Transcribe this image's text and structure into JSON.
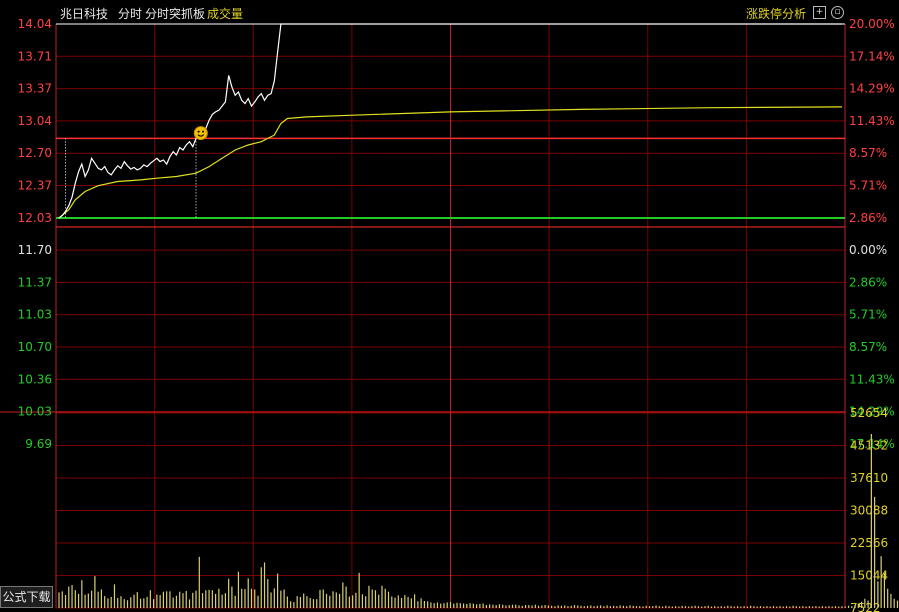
{
  "header": {
    "stock_name": "兆日科技",
    "menu_intraday": "分时",
    "menu_breakout": "分时突抓板",
    "volume_label": "成交量",
    "limit_analysis": "涨跌停分析",
    "plus_icon": "plus-icon",
    "circle_icon": "circle-toggle-icon"
  },
  "footer": {
    "formula_download": "公式下载"
  },
  "colors": {
    "up": "#ff4040",
    "down": "#22cc22",
    "neutral": "#e0e0e0",
    "grid": "#7a0000",
    "price_line": "#ffffff",
    "avg_line": "#e0e020",
    "volume": "#d8d070",
    "accent": "#e0d020"
  },
  "chart_data": {
    "type": "line",
    "base_price": 11.7,
    "price_axis_labels": [
      "14.04",
      "13.71",
      "13.37",
      "13.04",
      "12.70",
      "12.37",
      "12.03",
      "11.70",
      "11.37",
      "11.03",
      "10.70",
      "10.36",
      "10.03",
      "9.69"
    ],
    "percent_axis_labels": [
      "20.00%",
      "17.14%",
      "14.29%",
      "11.43%",
      "8.57%",
      "5.71%",
      "2.86%",
      "0.00%",
      "2.86%",
      "5.71%",
      "8.57%",
      "11.43%",
      "14.29%",
      "17.14%"
    ],
    "volume_axis_labels": [
      "52654",
      "45132",
      "37610",
      "30088",
      "22566",
      "15044",
      "7522"
    ],
    "ylim": [
      9.36,
      14.04
    ],
    "volume_max": 52654,
    "session_minutes": 240,
    "limit_up_price": 14.04,
    "reference_price": 12.66,
    "series": [
      {
        "points": [
          [
            0,
            11.7
          ],
          [
            1,
            11.73
          ],
          [
            2,
            11.78
          ],
          [
            3,
            11.85
          ],
          [
            4,
            11.95
          ],
          [
            5,
            12.12
          ],
          [
            6,
            12.26
          ],
          [
            7,
            12.35
          ],
          [
            8,
            12.2
          ],
          [
            9,
            12.28
          ],
          [
            10,
            12.42
          ],
          [
            11,
            12.36
          ],
          [
            12,
            12.3
          ],
          [
            13,
            12.28
          ],
          [
            14,
            12.32
          ],
          [
            15,
            12.25
          ],
          [
            16,
            12.22
          ],
          [
            17,
            12.28
          ],
          [
            18,
            12.33
          ],
          [
            19,
            12.3
          ],
          [
            20,
            12.38
          ],
          [
            21,
            12.33
          ],
          [
            22,
            12.29
          ],
          [
            23,
            12.31
          ],
          [
            24,
            12.28
          ],
          [
            25,
            12.3
          ],
          [
            26,
            12.34
          ],
          [
            27,
            12.32
          ],
          [
            28,
            12.36
          ],
          [
            29,
            12.39
          ],
          [
            30,
            12.42
          ],
          [
            31,
            12.38
          ],
          [
            32,
            12.4
          ],
          [
            33,
            12.35
          ],
          [
            34,
            12.44
          ],
          [
            35,
            12.5
          ],
          [
            36,
            12.46
          ],
          [
            37,
            12.55
          ],
          [
            38,
            12.52
          ],
          [
            39,
            12.58
          ],
          [
            40,
            12.62
          ],
          [
            41,
            12.56
          ],
          [
            42,
            12.66
          ],
          [
            43,
            12.72
          ],
          [
            44,
            12.7
          ],
          [
            45,
            12.78
          ],
          [
            46,
            12.88
          ],
          [
            47,
            12.95
          ],
          [
            48,
            12.98
          ],
          [
            49,
            13.0
          ],
          [
            50,
            13.05
          ],
          [
            51,
            13.1
          ],
          [
            52,
            13.42
          ],
          [
            53,
            13.28
          ],
          [
            54,
            13.18
          ],
          [
            55,
            13.22
          ],
          [
            56,
            13.12
          ],
          [
            57,
            13.08
          ],
          [
            58,
            13.14
          ],
          [
            59,
            13.05
          ],
          [
            60,
            13.1
          ],
          [
            61,
            13.16
          ],
          [
            62,
            13.2
          ],
          [
            63,
            13.12
          ],
          [
            64,
            13.18
          ],
          [
            65,
            13.2
          ],
          [
            66,
            13.35
          ],
          [
            67,
            13.7
          ],
          [
            68,
            14.04
          ],
          [
            240,
            14.04
          ]
        ]
      },
      {
        "points": [
          [
            0,
            11.7
          ],
          [
            3,
            11.8
          ],
          [
            5,
            11.92
          ],
          [
            8,
            12.02
          ],
          [
            12,
            12.09
          ],
          [
            18,
            12.14
          ],
          [
            25,
            12.16
          ],
          [
            30,
            12.18
          ],
          [
            36,
            12.2
          ],
          [
            42,
            12.24
          ],
          [
            46,
            12.32
          ],
          [
            50,
            12.42
          ],
          [
            54,
            12.52
          ],
          [
            58,
            12.58
          ],
          [
            62,
            12.62
          ],
          [
            66,
            12.7
          ],
          [
            68,
            12.84
          ],
          [
            70,
            12.9
          ],
          [
            76,
            12.92
          ],
          [
            90,
            12.94
          ],
          [
            120,
            12.98
          ],
          [
            160,
            13.01
          ],
          [
            200,
            13.03
          ],
          [
            240,
            13.04
          ]
        ]
      }
    ],
    "volumes": [
      4200,
      4500,
      3500,
      5800,
      6200,
      4800,
      3800,
      7500,
      3600,
      3900,
      4700,
      8600,
      4400,
      5000,
      3200,
      2600,
      3000,
      6400,
      2700,
      3200,
      2400,
      2100,
      2900,
      3600,
      4300,
      2500,
      2600,
      3000,
      4800,
      2400,
      3600,
      3500,
      4400,
      4500,
      4500,
      2800,
      3300,
      4400,
      4000,
      4600,
      2300,
      4100,
      4700,
      13800,
      4000,
      4800,
      4900,
      4800,
      3800,
      5200,
      3600,
      4000,
      7900,
      5800,
      3300,
      9800,
      5200,
      5100,
      8000,
      5200,
      5000,
      3300,
      11000,
      12300,
      7800,
      4200,
      5300,
      9300,
      4700,
      5000,
      3100,
      1800,
      1600,
      3200,
      3000,
      3900,
      3200,
      2700,
      2400,
      2400,
      4900,
      5000,
      3800,
      3300,
      4500,
      4200,
      3800,
      6900,
      5800,
      3100,
      3400,
      4100,
      9500,
      3700,
      3200,
      6000,
      5000,
      4800,
      3600,
      6000,
      5200,
      4400,
      3100,
      2800,
      3400,
      2700,
      3500,
      3000,
      2600,
      3700,
      1800,
      2600,
      1900,
      1800,
      1500,
      1300,
      1500,
      1200,
      1300,
      1500,
      1600,
      1200,
      1400,
      1300,
      1200,
      1100,
      1300,
      1200,
      1000,
      1100,
      1200,
      800,
      1000,
      900,
      800,
      1000,
      900,
      700,
      800,
      900,
      900,
      700,
      600,
      800,
      800,
      700,
      900,
      600,
      700,
      800,
      700,
      600,
      500,
      700,
      600,
      700,
      500,
      600,
      800,
      700,
      600,
      500,
      600,
      700,
      500,
      600,
      700,
      500,
      700,
      500,
      600,
      500,
      700,
      600,
      500,
      700,
      600,
      500,
      500,
      400,
      600,
      500,
      500,
      700,
      500,
      400,
      600,
      500,
      400,
      500,
      400,
      600,
      500,
      400,
      500,
      600,
      500,
      400,
      500,
      600,
      400,
      500,
      400,
      500,
      400,
      600,
      500,
      400,
      500,
      400,
      500,
      400,
      600,
      500,
      400,
      500,
      400,
      500,
      400,
      500,
      400,
      500,
      400,
      500,
      400,
      600,
      500,
      400,
      500,
      400,
      500,
      400,
      500,
      400,
      500,
      400,
      500,
      400,
      500,
      400,
      500,
      400,
      600,
      500,
      800,
      1200,
      1700,
      2500,
      2000,
      47000,
      30000,
      7200,
      14000,
      9500,
      5200,
      3800,
      2500,
      2000
    ]
  }
}
